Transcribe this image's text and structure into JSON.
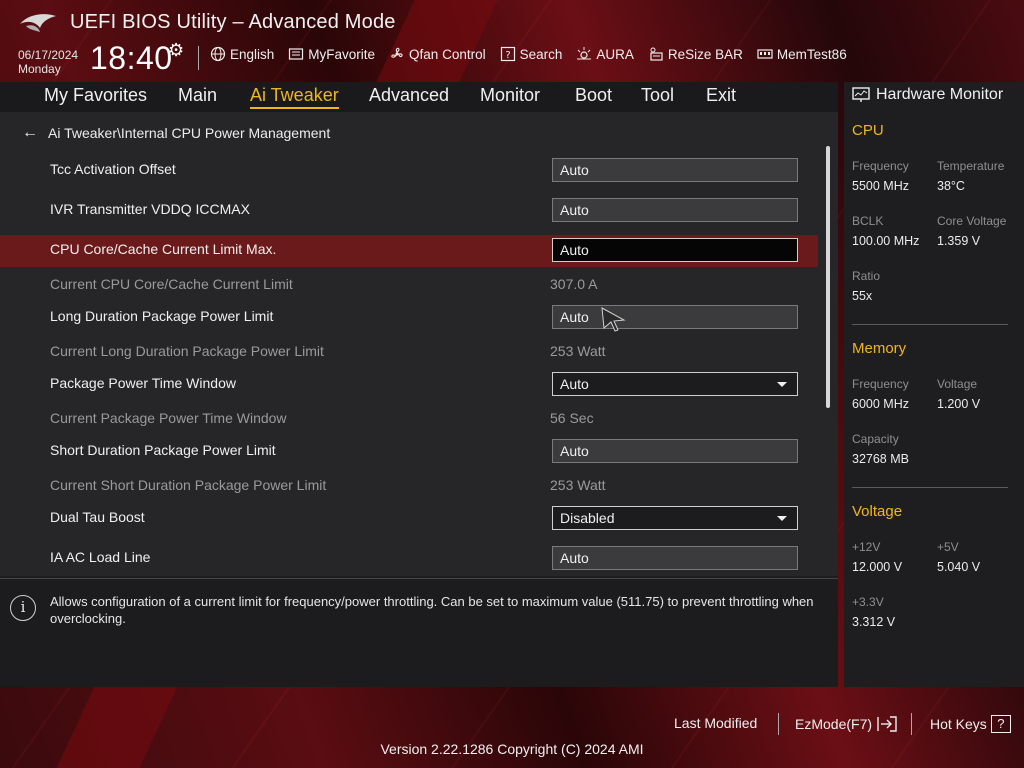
{
  "header": {
    "title": "UEFI BIOS Utility – Advanced Mode",
    "date": "06/17/2024",
    "day": "Monday",
    "time": "18:40",
    "toolbar": [
      {
        "label": "English",
        "icon": "globe-icon"
      },
      {
        "label": "MyFavorite",
        "icon": "favorite-icon"
      },
      {
        "label": "Qfan Control",
        "icon": "fan-icon"
      },
      {
        "label": "Search",
        "icon": "search-icon"
      },
      {
        "label": "AURA",
        "icon": "aura-icon"
      },
      {
        "label": "ReSize BAR",
        "icon": "resize-bar-icon"
      },
      {
        "label": "MemTest86",
        "icon": "memtest-icon"
      }
    ]
  },
  "nav": {
    "tabs": [
      {
        "label": "My Favorites"
      },
      {
        "label": "Main"
      },
      {
        "label": "Ai Tweaker",
        "active": true
      },
      {
        "label": "Advanced"
      },
      {
        "label": "Monitor"
      },
      {
        "label": "Boot"
      },
      {
        "label": "Tool"
      },
      {
        "label": "Exit"
      }
    ]
  },
  "breadcrumb": "Ai Tweaker\\Internal CPU Power Management",
  "settings": [
    {
      "label": "Tcc Activation Offset",
      "value": "Auto",
      "kind": "field"
    },
    {
      "label": "IVR Transmitter VDDQ ICCMAX",
      "value": "Auto",
      "kind": "field"
    },
    {
      "label": "CPU Core/Cache Current Limit Max.",
      "value": "Auto",
      "kind": "field",
      "selected": true
    },
    {
      "label": "Current CPU Core/Cache Current Limit",
      "value": "307.0 A",
      "kind": "info"
    },
    {
      "label": "Long Duration Package Power Limit",
      "value": "Auto",
      "kind": "field"
    },
    {
      "label": "Current Long Duration Package Power Limit",
      "value": "253 Watt",
      "kind": "info"
    },
    {
      "label": "Package Power Time Window",
      "value": "Auto",
      "kind": "dropdown"
    },
    {
      "label": "Current Package Power Time Window",
      "value": "56 Sec",
      "kind": "info"
    },
    {
      "label": "Short Duration Package Power Limit",
      "value": "Auto",
      "kind": "field"
    },
    {
      "label": "Current Short Duration Package Power Limit",
      "value": "253 Watt",
      "kind": "info"
    },
    {
      "label": "Dual Tau Boost",
      "value": "Disabled",
      "kind": "dropdown"
    },
    {
      "label": "IA AC Load Line",
      "value": "Auto",
      "kind": "field"
    }
  ],
  "help": {
    "text": "Allows configuration of a current limit for frequency/power throttling. Can be set to maximum value (511.75) to prevent throttling when overclocking."
  },
  "hardware_monitor": {
    "title": "Hardware Monitor",
    "cpu": {
      "heading": "CPU",
      "frequency_label": "Frequency",
      "frequency": "5500 MHz",
      "temperature_label": "Temperature",
      "temperature": "38°C",
      "bclk_label": "BCLK",
      "bclk": "100.00 MHz",
      "core_voltage_label": "Core Voltage",
      "core_voltage": "1.359 V",
      "ratio_label": "Ratio",
      "ratio": "55x"
    },
    "memory": {
      "heading": "Memory",
      "frequency_label": "Frequency",
      "frequency": "6000 MHz",
      "voltage_label": "Voltage",
      "voltage": "1.200 V",
      "capacity_label": "Capacity",
      "capacity": "32768 MB"
    },
    "voltage": {
      "heading": "Voltage",
      "v12_label": "+12V",
      "v12": "12.000 V",
      "v5_label": "+5V",
      "v5": "5.040 V",
      "v33_label": "+3.3V",
      "v33": "3.312 V"
    }
  },
  "footer": {
    "last_modified": "Last Modified",
    "ezmode": "EzMode(F7)",
    "hotkeys": "Hot Keys",
    "hotkeys_key": "?",
    "version": "Version 2.22.1286 Copyright (C) 2024 AMI"
  },
  "colors": {
    "accent": "#f0b61e",
    "highlight_row": "#6b1a1c",
    "background_red": "#5a0d12"
  }
}
